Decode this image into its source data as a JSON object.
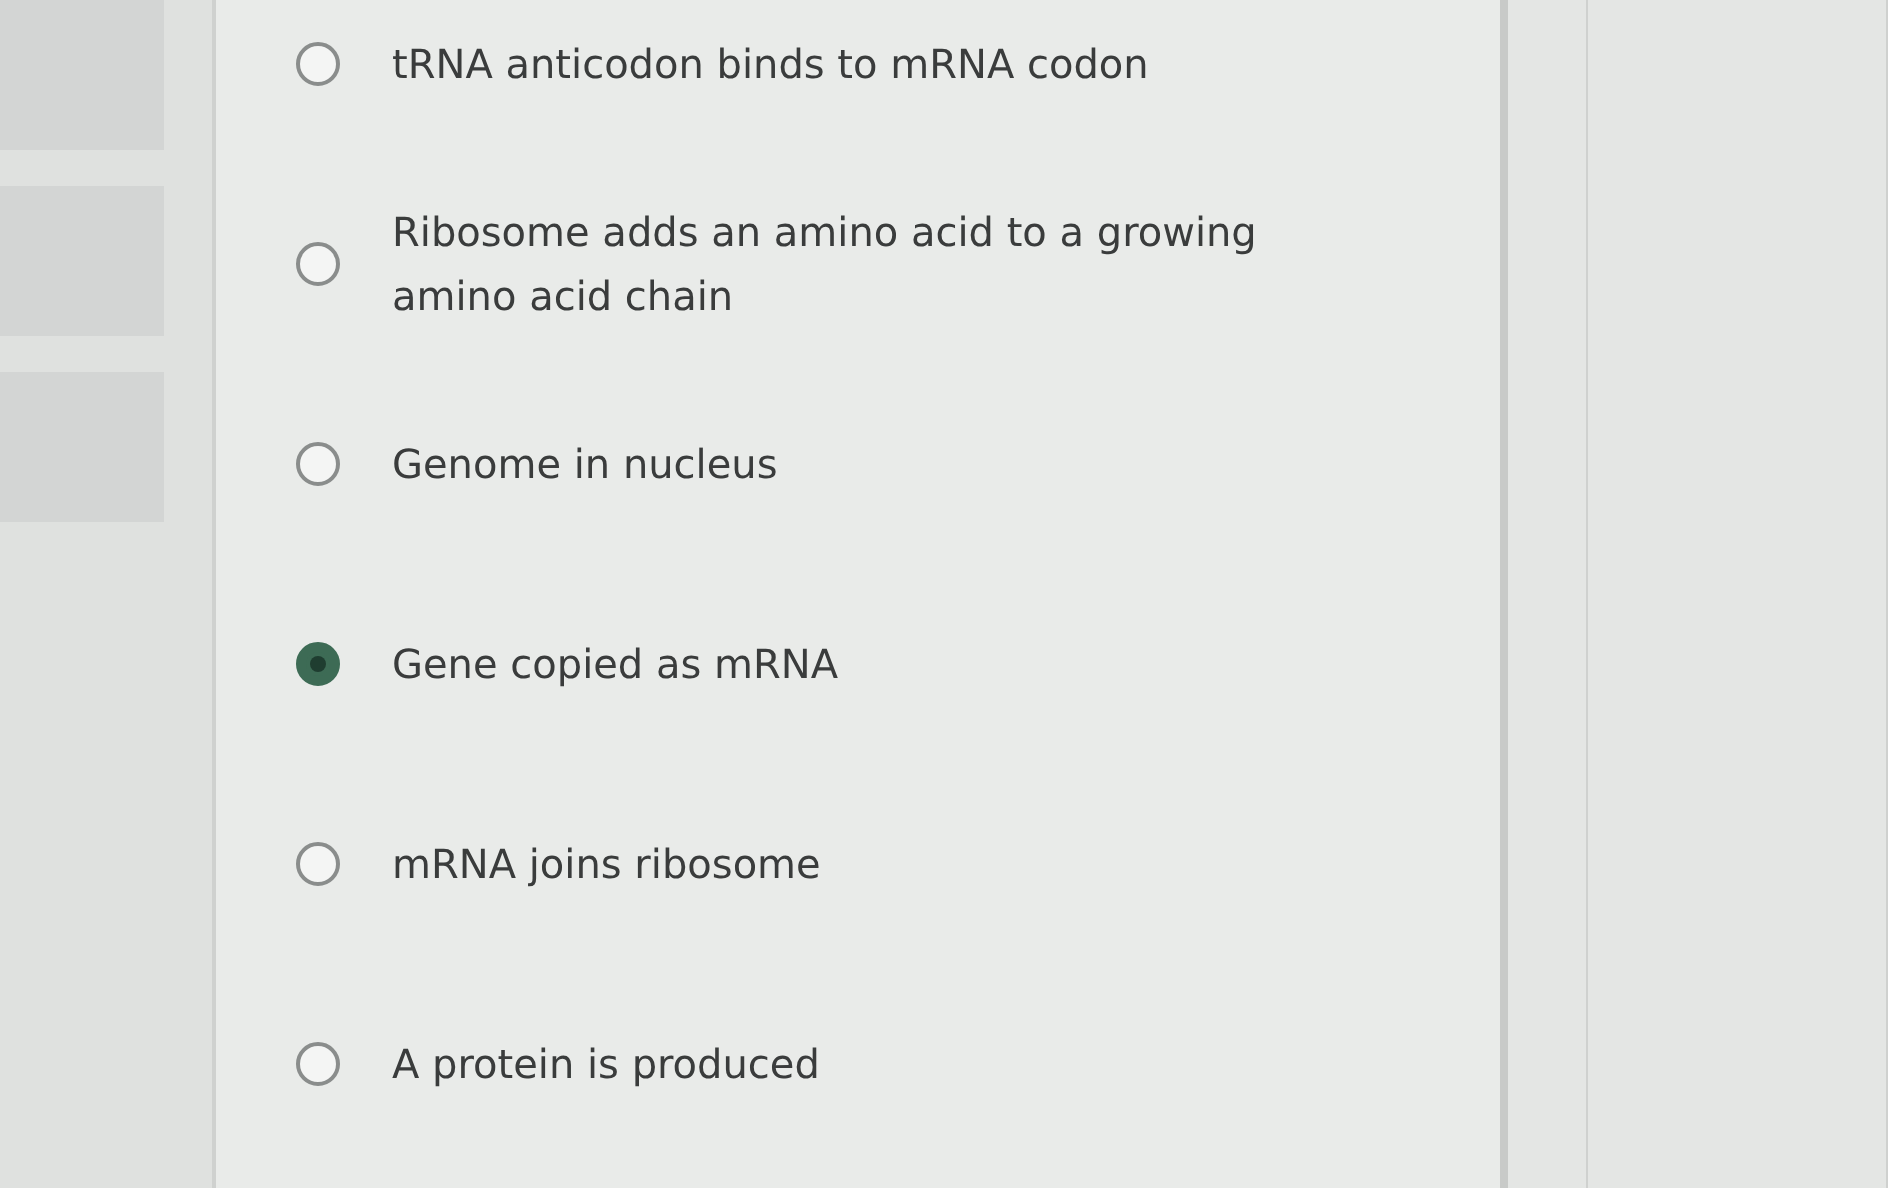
{
  "options": [
    {
      "label": "tRNA anticodon binds to mRNA codon",
      "selected": false
    },
    {
      "label": "Ribosome adds an amino acid to a growing amino acid chain",
      "selected": false
    },
    {
      "label": "Genome in nucleus",
      "selected": false
    },
    {
      "label": "Gene copied as mRNA",
      "selected": true
    },
    {
      "label": "mRNA joins ribosome",
      "selected": false
    },
    {
      "label": "A protein is produced",
      "selected": false
    }
  ]
}
